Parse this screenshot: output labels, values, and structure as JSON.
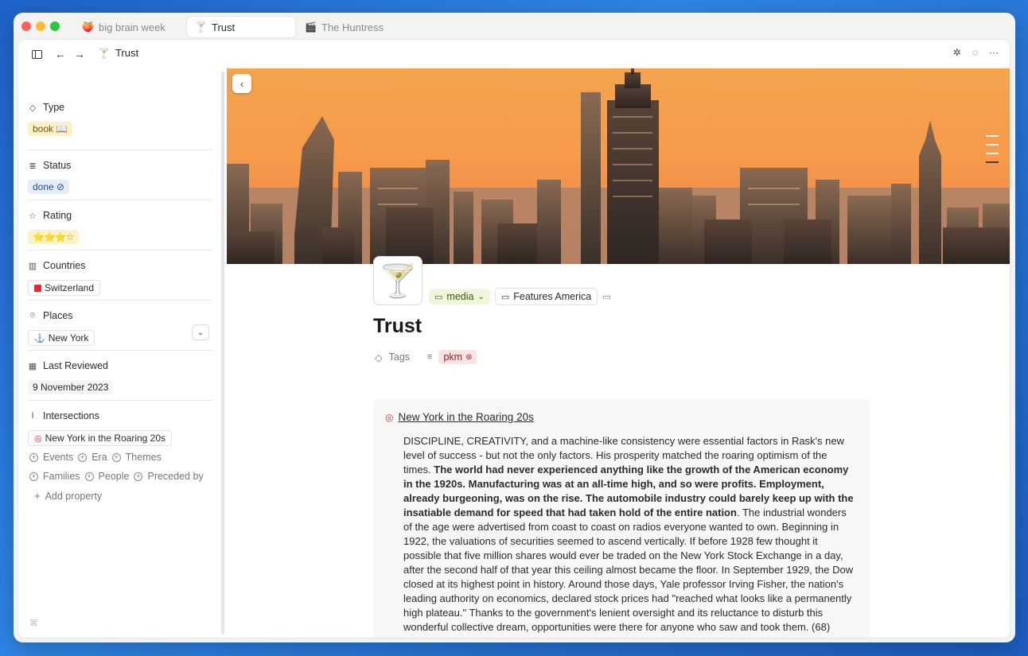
{
  "tabs": [
    {
      "icon": "peach-icon",
      "glyph": "🍑",
      "label": "big brain week"
    },
    {
      "icon": "cocktail-icon",
      "glyph": "🍸",
      "label": "Trust"
    },
    {
      "icon": "clapper-icon",
      "glyph": "🎬",
      "label": "The Huntress"
    }
  ],
  "navbar": {
    "breadcrumb": "Trust"
  },
  "sidebar": {
    "type": {
      "label": "Type",
      "value": "book 📖"
    },
    "status": {
      "label": "Status",
      "value": "done ⊘"
    },
    "rating": {
      "label": "Rating",
      "value": "⭐⭐⭐☆"
    },
    "countries": {
      "label": "Countries",
      "value": "Switzerland"
    },
    "places": {
      "label": "Places",
      "value": "New York"
    },
    "last_reviewed": {
      "label": "Last Reviewed",
      "value": "9 November 2023"
    },
    "intersections": {
      "label": "Intersections",
      "value": "New York in the Roaring 20s"
    },
    "extra_props_row1": [
      "Events",
      "Era",
      "Themes"
    ],
    "extra_props_row2": [
      "Families",
      "People",
      "Preceded by"
    ],
    "add_property": "Add property"
  },
  "page": {
    "title": "Trust",
    "media_label": "media",
    "features_label": "Features America",
    "tags_label": "Tags",
    "tag_pkm": "pkm"
  },
  "callout": {
    "title": "New York in the Roaring 20s",
    "body_1": "DISCIPLINE, CREATIVITY, and a machine-like consistency were essential factors in Rask's new level of success - but not the only factors. His prosperity matched the roaring optimism of the times. ",
    "body_bold": "The world had never experienced anything like the growth of the American economy in the 1920s. Manufacturing was at an all-time high, and so were profits. Employment, already burgeoning, was on the rise. The automobile industry could barely keep up with the insatiable demand for speed that had taken hold of the entire nation",
    "body_2": ". The industrial wonders of the age were advertised from coast to coast on radios everyone wanted to own. Beginning in 1922, the valuations of securities seemed to ascend vertically. If before 1928 few thought it possible that five million shares would ever be traded on the New York Stock Exchange in a day, after the second half of that year this ceiling almost became the floor. In September 1929, the Dow closed at its highest point in history. Around those days, Yale professor Irving Fisher, the nation's leading authority on economics, declared stock prices had \"reached what looks like a permanently high plateau.\" Thanks to the government's lenient oversight and its reluctance to disturb this wonderful collective dream, opportunities were there for anyone who saw and took them. (68)"
  },
  "colors": {
    "accent_sky": "#f69a4b",
    "window_bg": "#f3f3f2"
  }
}
